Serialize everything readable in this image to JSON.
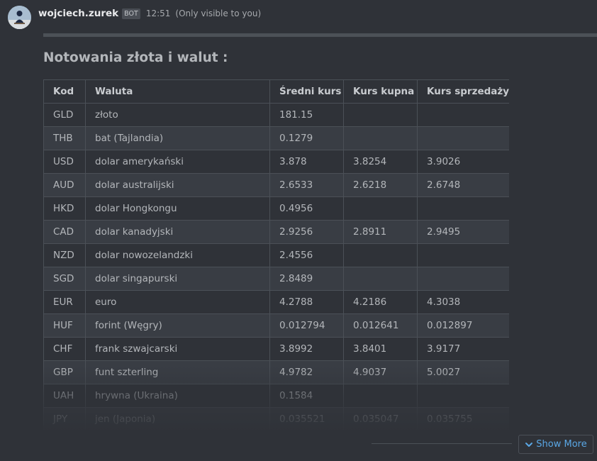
{
  "author": {
    "name": "wojciech.zurek",
    "badge": "BOT",
    "time": "12:51",
    "visibility": "(Only visible to you)"
  },
  "attachment": {
    "title": "Notowania złota i walut :",
    "columns": [
      "Kod",
      "Waluta",
      "Średni kurs",
      "Kurs kupna",
      "Kurs sprzedaży"
    ],
    "rows": [
      [
        "GLD",
        "złoto",
        "181.15",
        "",
        ""
      ],
      [
        "THB",
        "bat (Tajlandia)",
        "0.1279",
        "",
        ""
      ],
      [
        "USD",
        "dolar amerykański",
        "3.878",
        "3.8254",
        "3.9026"
      ],
      [
        "AUD",
        "dolar australijski",
        "2.6533",
        "2.6218",
        "2.6748"
      ],
      [
        "HKD",
        "dolar Hongkongu",
        "0.4956",
        "",
        ""
      ],
      [
        "CAD",
        "dolar kanadyjski",
        "2.9256",
        "2.8911",
        "2.9495"
      ],
      [
        "NZD",
        "dolar nowozelandzki",
        "2.4556",
        "",
        ""
      ],
      [
        "SGD",
        "dolar singapurski",
        "2.8489",
        "",
        ""
      ],
      [
        "EUR",
        "euro",
        "4.2788",
        "4.2186",
        "4.3038"
      ],
      [
        "HUF",
        "forint (Węgry)",
        "0.012794",
        "0.012641",
        "0.012897"
      ],
      [
        "CHF",
        "frank szwajcarski",
        "3.8992",
        "3.8401",
        "3.9177"
      ],
      [
        "GBP",
        "funt szterling",
        "4.9782",
        "4.9037",
        "5.0027"
      ],
      [
        "UAH",
        "hrywna (Ukraina)",
        "0.1584",
        "",
        ""
      ],
      [
        "JPY",
        "jen (Japonia)",
        "0.035521",
        "0.035047",
        "0.035755"
      ]
    ]
  },
  "show_more": {
    "label": "Show More",
    "icon": "chevron-down-icon"
  },
  "colors": {
    "background": "#2f3238",
    "link": "#5aa7e5",
    "border": "#4b5057",
    "stripe": "#393d44"
  }
}
